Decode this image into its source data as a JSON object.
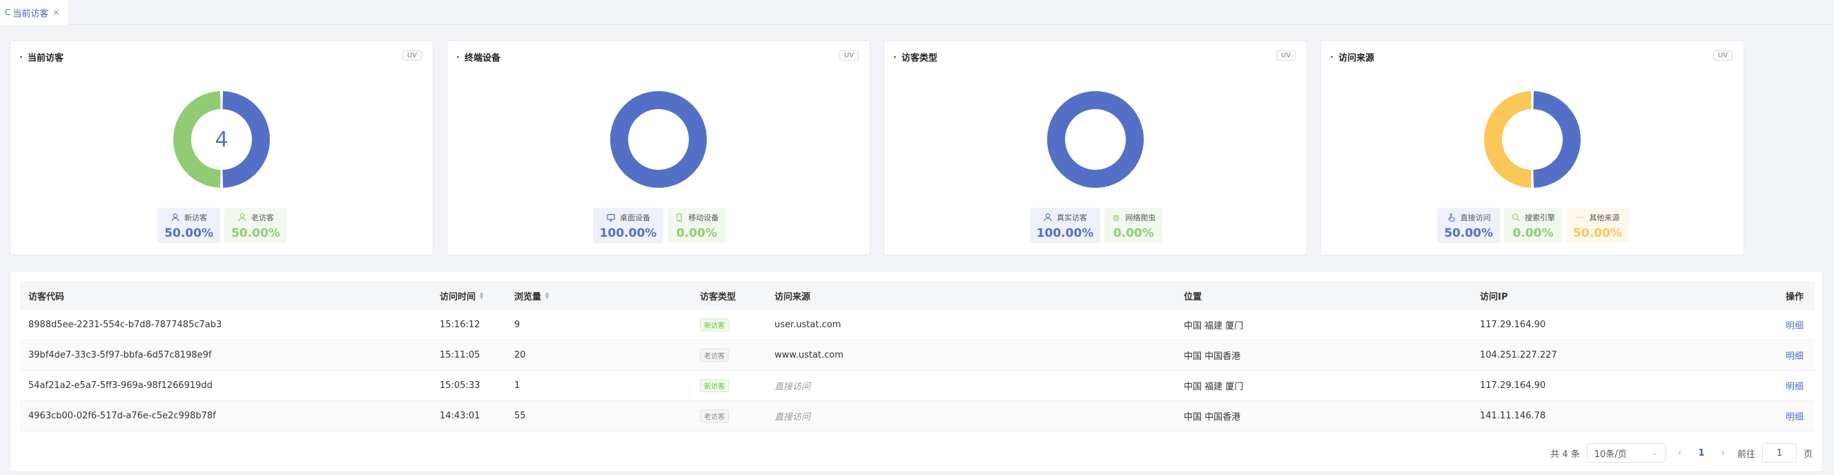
{
  "tab": {
    "icon": "C",
    "label": "当前访客",
    "close": "×"
  },
  "colors": {
    "blue": "#5470c6",
    "green": "#91cc75",
    "yellow": "#fac858"
  },
  "cards": [
    {
      "title": "当前访客",
      "badge": "UV",
      "center": "4",
      "slices": [
        {
          "value": 50,
          "color": "#5470c6"
        },
        {
          "value": 50,
          "color": "#91cc75"
        }
      ],
      "legend": [
        {
          "icon": "user-icon",
          "label": "新访客",
          "value": "50.00%",
          "tone": "blue"
        },
        {
          "icon": "user-icon",
          "label": "老访客",
          "value": "50.00%",
          "tone": "green"
        }
      ]
    },
    {
      "title": "终端设备",
      "badge": "UV",
      "center": "",
      "slices": [
        {
          "value": 100,
          "color": "#5470c6"
        },
        {
          "value": 0,
          "color": "#91cc75"
        }
      ],
      "legend": [
        {
          "icon": "monitor-icon",
          "label": "桌面设备",
          "value": "100.00%",
          "tone": "blue"
        },
        {
          "icon": "mobile-icon",
          "label": "移动设备",
          "value": "0.00%",
          "tone": "green"
        }
      ]
    },
    {
      "title": "访客类型",
      "badge": "UV",
      "center": "",
      "slices": [
        {
          "value": 100,
          "color": "#5470c6"
        },
        {
          "value": 0,
          "color": "#91cc75"
        }
      ],
      "legend": [
        {
          "icon": "user-icon",
          "label": "真实访客",
          "value": "100.00%",
          "tone": "blue"
        },
        {
          "icon": "bug-icon",
          "label": "网络爬虫",
          "value": "0.00%",
          "tone": "green"
        }
      ]
    },
    {
      "title": "访问来源",
      "badge": "UV",
      "center": "",
      "slices": [
        {
          "value": 50,
          "color": "#5470c6"
        },
        {
          "value": 0,
          "color": "#91cc75"
        },
        {
          "value": 50,
          "color": "#fac858"
        }
      ],
      "legend": [
        {
          "icon": "pointer-icon",
          "label": "直接访问",
          "value": "50.00%",
          "tone": "blue"
        },
        {
          "icon": "search-icon",
          "label": "搜索引擎",
          "value": "0.00%",
          "tone": "green"
        },
        {
          "icon": "more-icon",
          "label": "其他来源",
          "value": "50.00%",
          "tone": "yellow"
        }
      ]
    }
  ],
  "table": {
    "headers": [
      "访客代码",
      "访问时间",
      "浏览量",
      "访客类型",
      "访问来源",
      "位置",
      "访问IP",
      "操作"
    ],
    "rows": [
      {
        "code": "8988d5ee-2231-554c-b7d8-7877485c7ab3",
        "time": "15:16:12",
        "views": "9",
        "type": "新访客",
        "typeKind": "new",
        "source": "user.ustat.com",
        "direct": false,
        "location": "中国 福建 厦门",
        "ip": "117.29.164.90",
        "action": "明细"
      },
      {
        "code": "39bf4de7-33c3-5f97-bbfa-6d57c8198e9f",
        "time": "15:11:05",
        "views": "20",
        "type": "老访客",
        "typeKind": "old",
        "source": "www.ustat.com",
        "direct": false,
        "location": "中国 中国香港",
        "ip": "104.251.227.227",
        "action": "明细"
      },
      {
        "code": "54af21a2-e5a7-5ff3-969a-98f1266919dd",
        "time": "15:05:33",
        "views": "1",
        "type": "新访客",
        "typeKind": "new",
        "source": "直接访问",
        "direct": true,
        "location": "中国 福建 厦门",
        "ip": "117.29.164.90",
        "action": "明细"
      },
      {
        "code": "4963cb00-02f6-517d-a76e-c5e2c998b78f",
        "time": "14:43:01",
        "views": "55",
        "type": "老访客",
        "typeKind": "old",
        "source": "直接访问",
        "direct": true,
        "location": "中国 中国香港",
        "ip": "141.11.146.78",
        "action": "明细"
      }
    ]
  },
  "pager": {
    "total": "共 4 条",
    "pageSize": "10条/页",
    "current": "1",
    "goto": "前往",
    "gotoValue": "1",
    "pageUnit": "页"
  }
}
